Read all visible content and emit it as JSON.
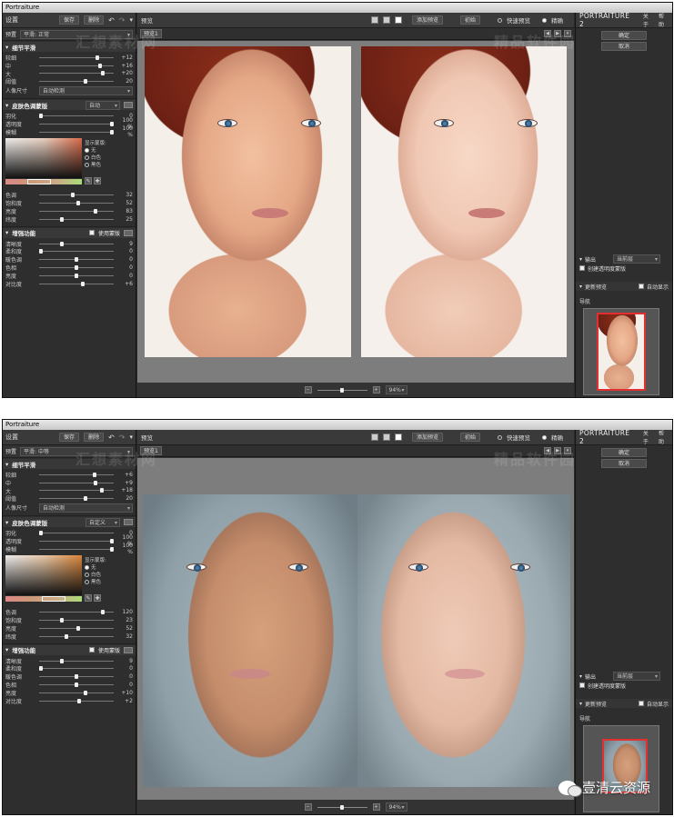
{
  "windows": [
    {
      "title": "Portraiture",
      "left_panel": {
        "header": {
          "title": "设置",
          "save": "保存",
          "delete": "删除"
        },
        "preset": {
          "label": "预置",
          "value": "平滑: 正常"
        },
        "detail_smoothing": {
          "title": "细节平滑",
          "sliders": [
            {
              "label": "较细",
              "value": "+12",
              "pos": 0.78
            },
            {
              "label": "中",
              "value": "+16",
              "pos": 0.82
            },
            {
              "label": "大",
              "value": "+20",
              "pos": 0.85
            },
            {
              "label": "阈值",
              "value": "20",
              "pos": 0.62
            }
          ],
          "portrait_size_label": "人像尺寸",
          "portrait_size_value": "自动检测"
        },
        "skin_mask": {
          "title": "皮肤色调蒙版",
          "mode": "自动",
          "sliders": [
            {
              "label": "羽化",
              "value": "0",
              "pos": 0.02
            },
            {
              "label": "透明度",
              "value": "100 %",
              "pos": 0.98
            },
            {
              "label": "模糊",
              "value": "100 %",
              "pos": 0.98
            }
          ],
          "display_label": "显示蒙版:",
          "display_options": [
            {
              "label": "无",
              "selected": true
            },
            {
              "label": "白色",
              "selected": false
            },
            {
              "label": "黑色",
              "selected": false
            }
          ],
          "color_sliders": [
            {
              "label": "色调",
              "value": "32",
              "pos": 0.45
            },
            {
              "label": "饱和度",
              "value": "52",
              "pos": 0.52
            },
            {
              "label": "亮度",
              "value": "83",
              "pos": 0.75
            },
            {
              "label": "纬度",
              "value": "25",
              "pos": 0.3
            }
          ]
        },
        "enhance": {
          "title": "增强功能",
          "use_mask": "使用蒙版",
          "sliders": [
            {
              "label": "清晰度",
              "value": "9",
              "pos": 0.3
            },
            {
              "label": "柔和度",
              "value": "0",
              "pos": 0.02
            },
            {
              "label": "暖色调",
              "value": "0",
              "pos": 0.5
            },
            {
              "label": "色相",
              "value": "0",
              "pos": 0.5
            },
            {
              "label": "亮度",
              "value": "0",
              "pos": 0.5
            },
            {
              "label": "对比度",
              "value": "+6",
              "pos": 0.58
            }
          ]
        }
      },
      "center": {
        "title": "预览",
        "add_preview": "添加预览",
        "original": "初始",
        "quick_preview": "快速预览",
        "select": "精确",
        "tab": "预览1",
        "zoom": "94%"
      },
      "right_panel": {
        "brand": "PORTRAITURE 2",
        "about": "关于",
        "help": "帮助",
        "ok": "确定",
        "cancel": "取消",
        "output_label": "输出",
        "output_value": "当前层",
        "create_transparent": "创建透明度蒙版",
        "refresh_preview": "更新预览",
        "auto_show": "自动显示",
        "navigator": "导航"
      },
      "watermarks": [
        "汇想素材网",
        "精品软件园"
      ]
    },
    {
      "title": "Portraiture",
      "left_panel": {
        "header": {
          "title": "设置",
          "save": "保存",
          "delete": "删除"
        },
        "preset": {
          "label": "预置",
          "value": "平滑: 中等"
        },
        "detail_smoothing": {
          "title": "细节平滑",
          "sliders": [
            {
              "label": "较细",
              "value": "+6",
              "pos": 0.74
            },
            {
              "label": "中",
              "value": "+9",
              "pos": 0.76
            },
            {
              "label": "大",
              "value": "+18",
              "pos": 0.84
            },
            {
              "label": "阈值",
              "value": "20",
              "pos": 0.62
            }
          ],
          "portrait_size_label": "人像尺寸",
          "portrait_size_value": "自动检测"
        },
        "skin_mask": {
          "title": "皮肤色调蒙版",
          "mode": "自定义",
          "sliders": [
            {
              "label": "羽化",
              "value": "0",
              "pos": 0.02
            },
            {
              "label": "透明度",
              "value": "100 %",
              "pos": 0.98
            },
            {
              "label": "模糊",
              "value": "100 %",
              "pos": 0.98
            }
          ],
          "display_label": "显示蒙版:",
          "display_options": [
            {
              "label": "无",
              "selected": true
            },
            {
              "label": "白色",
              "selected": false
            },
            {
              "label": "黑色",
              "selected": false
            }
          ],
          "color_sliders": [
            {
              "label": "色调",
              "value": "120",
              "pos": 0.85
            },
            {
              "label": "饱和度",
              "value": "23",
              "pos": 0.3
            },
            {
              "label": "亮度",
              "value": "52",
              "pos": 0.52
            },
            {
              "label": "纬度",
              "value": "32",
              "pos": 0.36
            }
          ]
        },
        "enhance": {
          "title": "增强功能",
          "use_mask": "使用蒙版",
          "sliders": [
            {
              "label": "清晰度",
              "value": "9",
              "pos": 0.3
            },
            {
              "label": "柔和度",
              "value": "0",
              "pos": 0.02
            },
            {
              "label": "暖色调",
              "value": "0",
              "pos": 0.5
            },
            {
              "label": "色相",
              "value": "0",
              "pos": 0.5
            },
            {
              "label": "亮度",
              "value": "+10",
              "pos": 0.62
            },
            {
              "label": "对比度",
              "value": "+2",
              "pos": 0.54
            }
          ]
        }
      },
      "center": {
        "title": "预览",
        "add_preview": "添加预览",
        "original": "初始",
        "quick_preview": "快速预览",
        "select": "精确",
        "tab": "预览1",
        "zoom": "94%"
      },
      "right_panel": {
        "brand": "PORTRAITURE 2",
        "about": "关于",
        "help": "帮助",
        "ok": "确定",
        "cancel": "取消",
        "output_label": "输出",
        "output_value": "当前层",
        "create_transparent": "创建透明度蒙版",
        "refresh_preview": "更新预览",
        "auto_show": "自动显示",
        "navigator": "导航"
      },
      "watermarks": [
        "汇想素材网",
        "精品软件园"
      ]
    }
  ],
  "footer_watermark": "壹清云资源"
}
